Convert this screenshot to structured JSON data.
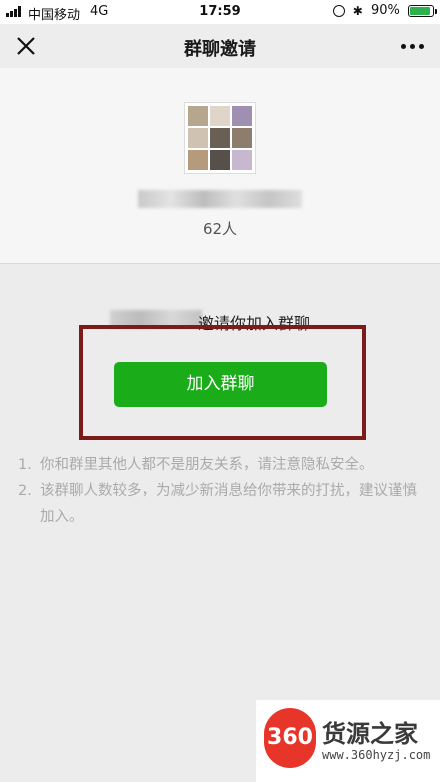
{
  "status_bar": {
    "carrier": "中国移动",
    "network": "4G",
    "time": "17:59",
    "battery": "90%",
    "battery_level": 0.9
  },
  "nav": {
    "title": "群聊邀请",
    "close_icon": "close-icon",
    "more_icon": "more-icon"
  },
  "group": {
    "member_count": "62人",
    "avatar_colors": [
      "#b7a68e",
      "#dfd5c9",
      "#9f8fb0",
      "#cfc2b3",
      "#6a5f55",
      "#8c7d6d",
      "#b69a7c",
      "#57504a",
      "#c7b8d0"
    ]
  },
  "invite": {
    "text": "邀请你加入群聊",
    "join_label": "加入群聊"
  },
  "notes": [
    {
      "num": "1.",
      "text": "你和群里其他人都不是朋友关系，请注意隐私安全。"
    },
    {
      "num": "2.",
      "text": "该群聊人数较多，为减少新消息给你带来的打扰，建议谨慎加入。"
    }
  ],
  "watermark": {
    "badge": "360",
    "title": "货源之家",
    "url": "www.360hyzj.com"
  },
  "colors": {
    "accent_green": "#1aad19",
    "highlight_frame": "#7b1c18",
    "background": "#ececec"
  }
}
